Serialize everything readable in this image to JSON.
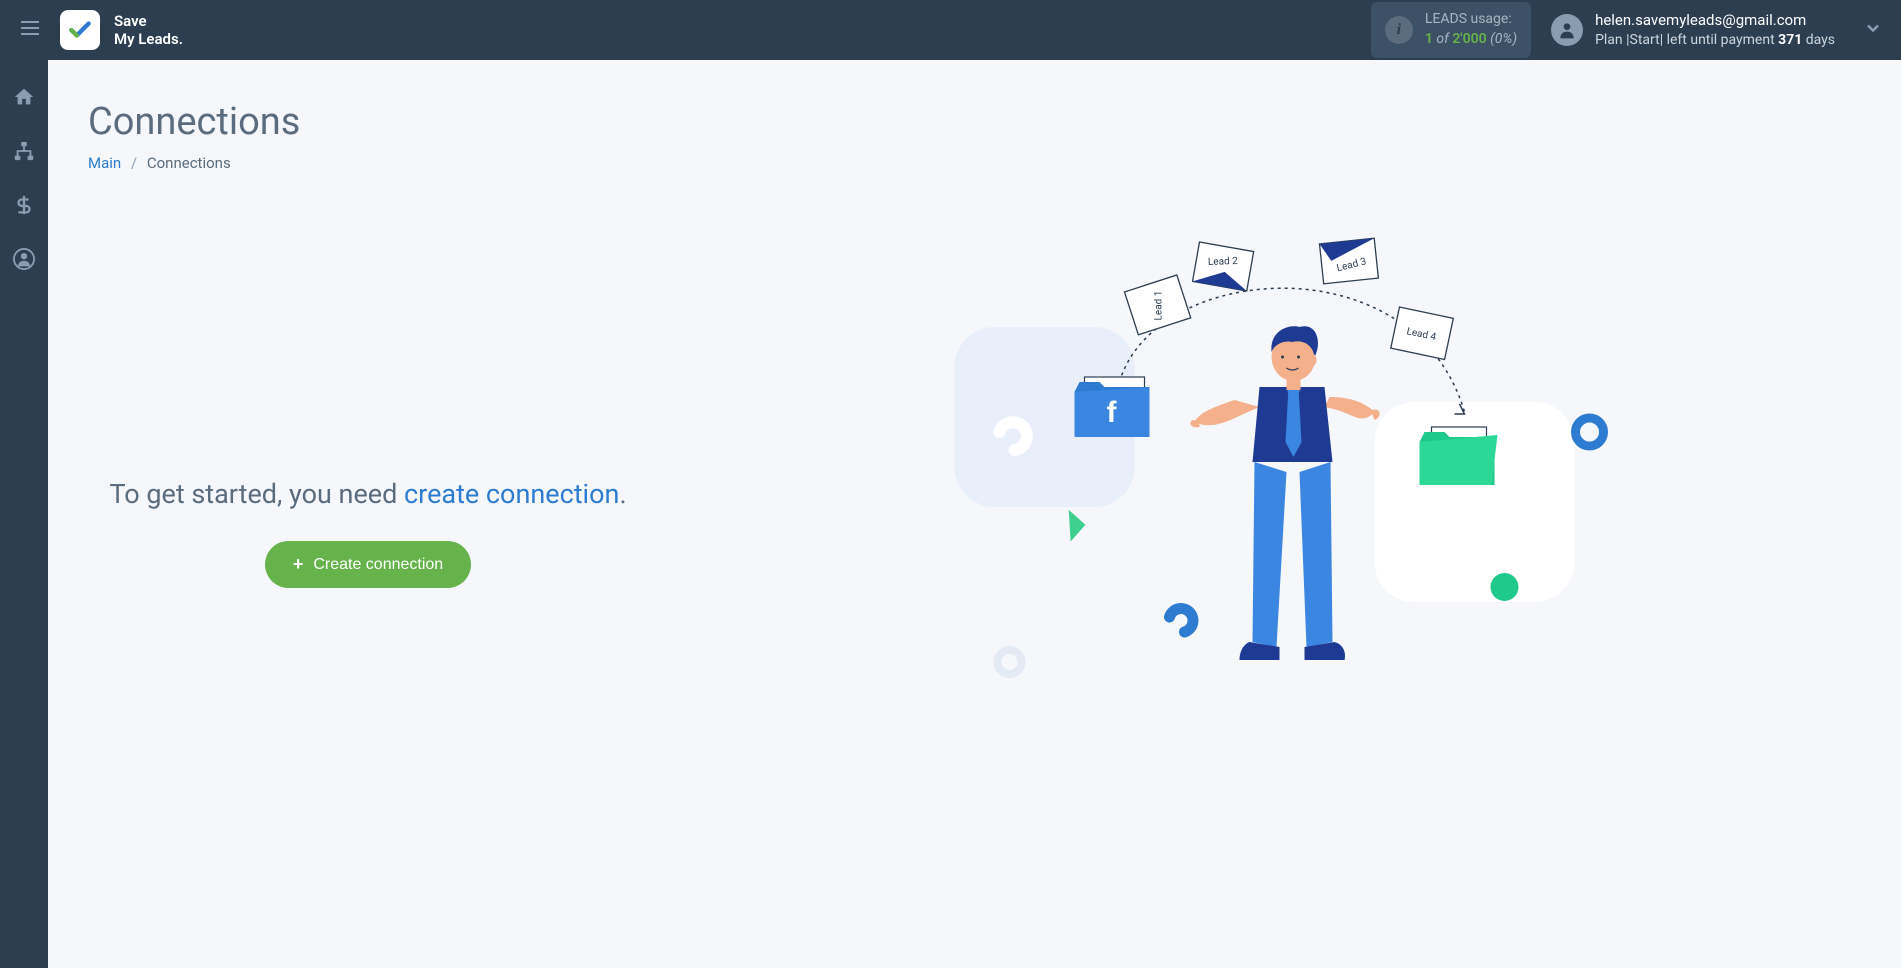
{
  "header": {
    "logo": {
      "line1": "Save",
      "line2": "My Leads."
    },
    "leads": {
      "label": "LEADS usage:",
      "count": "1",
      "of_word": "of",
      "total": "2'000",
      "percent": "(0%)"
    },
    "user": {
      "email": "helen.savemyleads@gmail.com",
      "plan_prefix": "Plan |Start| left until payment ",
      "days": "371",
      "days_suffix": " days"
    }
  },
  "sidebar": {
    "items": [
      "home",
      "connections",
      "billing",
      "account"
    ]
  },
  "page": {
    "title": "Connections",
    "breadcrumb": {
      "main": "Main",
      "current": "Connections"
    },
    "cta_prefix": "To get started, you need ",
    "cta_link": "create connection",
    "cta_suffix": ".",
    "button_label": "Create connection"
  },
  "illustration": {
    "lead_labels": [
      "Lead 1",
      "Lead 2",
      "Lead 3",
      "Lead 4"
    ]
  }
}
